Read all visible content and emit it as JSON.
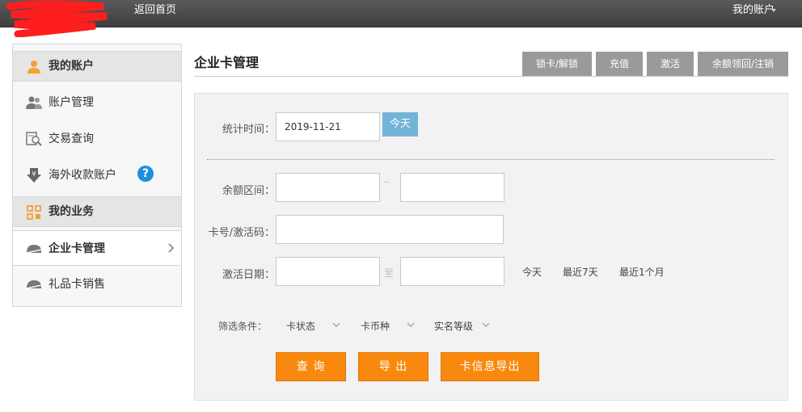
{
  "topbar": {
    "home_link": "返回首页",
    "account_menu": "我的账户"
  },
  "sidebar": {
    "section_account": "我的账户",
    "items_account": [
      {
        "label": "账户管理"
      },
      {
        "label": "交易查询"
      },
      {
        "label": "海外收款账户"
      }
    ],
    "section_business": "我的业务",
    "items_business": [
      {
        "label": "企业卡管理"
      },
      {
        "label": "礼品卡销售"
      }
    ],
    "help_glyph": "?"
  },
  "main": {
    "title": "企业卡管理",
    "actions": [
      {
        "label": "锁卡/解锁"
      },
      {
        "label": "充值"
      },
      {
        "label": "激活"
      },
      {
        "label": "余额领回/注销"
      }
    ]
  },
  "form": {
    "stat_time_label": "统计时间：",
    "stat_time_value": "2019-11-21",
    "today_button": "今天",
    "balance_label": "余额区间：",
    "balance_sep": "–",
    "card_label": "卡号/激活码：",
    "activation_label": "激活日期：",
    "activation_sep": "至",
    "quick_ranges": [
      "今天",
      "最近7天",
      "最近1个月"
    ],
    "filter_label": "筛选条件：",
    "filters": [
      {
        "label": "卡状态"
      },
      {
        "label": "卡币种"
      },
      {
        "label": "实名等级"
      }
    ],
    "buttons": {
      "query": "查 询",
      "export": "导 出",
      "export_card": "卡信息导出"
    }
  },
  "colors": {
    "accent_orange": "#f9890e",
    "today_blue": "#73b3d8",
    "tab_gray": "#9a9a9a",
    "help_blue": "#1e8fdc",
    "topbar": "#4a4a4a"
  }
}
